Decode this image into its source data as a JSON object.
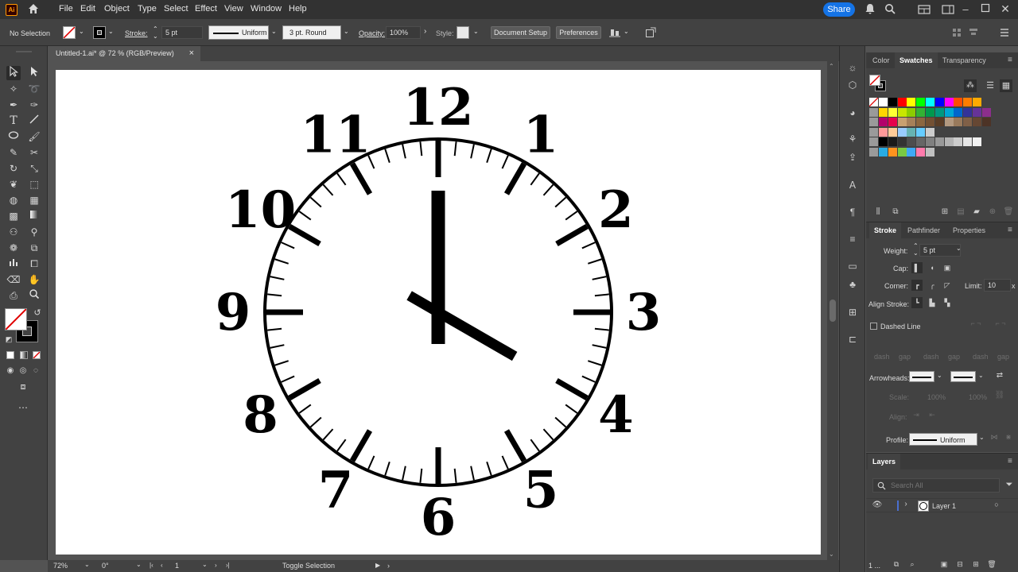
{
  "app": {
    "logo": "Ai"
  },
  "menu": [
    "File",
    "Edit",
    "Object",
    "Type",
    "Select",
    "Effect",
    "View",
    "Window",
    "Help"
  ],
  "share_label": "Share",
  "control": {
    "selection": "No Selection",
    "stroke_label": "Stroke:",
    "stroke_value": "5 pt",
    "profile": "Uniform",
    "brush": "3 pt. Round",
    "opacity_label": "Opacity:",
    "opacity_value": "100%",
    "style_label": "Style:",
    "document_setup": "Document Setup",
    "preferences": "Preferences"
  },
  "doc_tab": {
    "title": "Untitled-1.ai* @ 72 % (RGB/Preview)",
    "close": "×"
  },
  "clock": {
    "numerals": [
      "12",
      "1",
      "2",
      "3",
      "4",
      "5",
      "6",
      "7",
      "8",
      "9",
      "10",
      "11"
    ],
    "hour_hand_hours": 4,
    "minute_hand_minutes": 0
  },
  "swatches_panel": {
    "tabs": [
      "Color",
      "Swatches",
      "Transparency"
    ],
    "active_tab": "Swatches",
    "rows": [
      [
        "#ffffff",
        "#000000",
        "#ff0000",
        "#ffff00",
        "#00ff00",
        "#00ffff",
        "#0000ff",
        "#ff00ff",
        "#ff4d00",
        "#ff7d00",
        "#ffaa00"
      ],
      [
        "#ffd400",
        "#ffff33",
        "#c8e600",
        "#8ccc00",
        "#33b233",
        "#00994d",
        "#009980",
        "#00a6d4",
        "#0066cc",
        "#333399",
        "#663399",
        "#8c2e8c"
      ],
      [
        "#b3006b",
        "#e6004c",
        "#c8a070",
        "#a6805a",
        "#8c6640",
        "#735033",
        "#5a3d26",
        "#b39980",
        "#997a5c",
        "#806047",
        "#664733",
        "#4d3326"
      ],
      [
        "#ff9999",
        "#ffcc99",
        "#99ccff",
        "#66b3b3",
        "#66ccff",
        "#cccccc"
      ],
      [
        "#000000",
        "#1a1a1a",
        "#333333",
        "#4d4d4d",
        "#666666",
        "#808080",
        "#999999",
        "#b3b3b3",
        "#cccccc",
        "#e6e6e6",
        "#f2f2f2"
      ],
      [
        "#29abe2",
        "#ff931e",
        "#7ac943",
        "#3fa9f5",
        "#ff7bac",
        "#c0c0c0"
      ]
    ]
  },
  "stroke_panel": {
    "tabs": [
      "Stroke",
      "Pathfinder",
      "Properties"
    ],
    "active_tab": "Stroke",
    "weight_label": "Weight:",
    "weight_value": "5 pt",
    "cap_label": "Cap:",
    "corner_label": "Corner:",
    "limit_label": "Limit:",
    "limit_value": "10",
    "limit_unit": "x",
    "align_label": "Align Stroke:",
    "dashed_label": "Dashed Line",
    "dash_labels": [
      "dash",
      "gap",
      "dash",
      "gap",
      "dash",
      "gap"
    ],
    "arrowheads_label": "Arrowheads:",
    "scale_label": "Scale:",
    "scale_values": [
      "100%",
      "100%"
    ],
    "align_label2": "Align:",
    "profile_label": "Profile:",
    "profile_value": "Uniform"
  },
  "layers_panel": {
    "title": "Layers",
    "search_placeholder": "Search All",
    "layer_name": "Layer 1",
    "footer_count": "1 ..."
  },
  "status": {
    "zoom": "72%",
    "rotation": "0°",
    "artboard": "1",
    "tool": "Toggle Selection"
  },
  "colors": {
    "accent": "#1473e6",
    "layer_color": "#4a6fd0"
  }
}
